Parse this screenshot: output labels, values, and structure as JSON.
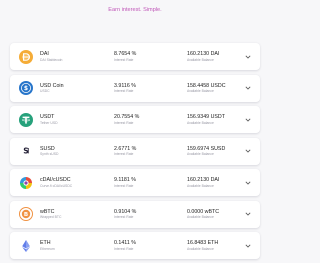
{
  "header": {
    "tagline": "Earn interest. Simple."
  },
  "assets": [
    {
      "symbol": "DAI",
      "name": "DAI Stablecoin",
      "rate": "8.7654 %",
      "rate_label": "Interest Rate",
      "balance": "160.2130 DAI",
      "balance_label": "Available Balance",
      "icon": "dai-icon"
    },
    {
      "symbol": "USD Coin",
      "name": "USDC",
      "rate": "3.9116 %",
      "rate_label": "Interest Rate",
      "balance": "158.4458 USDC",
      "balance_label": "Available Balance",
      "icon": "usdc-icon"
    },
    {
      "symbol": "USDT",
      "name": "Tether USD",
      "rate": "20.7554 %",
      "rate_label": "Interest Rate",
      "balance": "156.9349 USDT",
      "balance_label": "Available Balance",
      "icon": "usdt-icon"
    },
    {
      "symbol": "SUSD",
      "name": "Synth sUSD",
      "rate": "2.6771 %",
      "rate_label": "Interest Rate",
      "balance": "159.6974 SUSD",
      "balance_label": "Available Balance",
      "icon": "susd-icon"
    },
    {
      "symbol": "cDAI/cUSDC",
      "name": "Curve.fi cDAI/cUSDC",
      "rate": "9.1181 %",
      "rate_label": "Interest Rate",
      "balance": "160.2130 DAI",
      "balance_label": "Available Balance",
      "icon": "curve-icon"
    },
    {
      "symbol": "wBTC",
      "name": "Wrapped BTC",
      "rate": "0.9104 %",
      "rate_label": "Interest Rate",
      "balance": "0.0000 wBTC",
      "balance_label": "Available Balance",
      "icon": "wbtc-icon"
    },
    {
      "symbol": "ETH",
      "name": "Ethereum",
      "rate": "0.1411 %",
      "rate_label": "Interest Rate",
      "balance": "16.8483 ETH",
      "balance_label": "Available Balance",
      "icon": "eth-icon"
    }
  ],
  "colors": {
    "accent": "#c056b8",
    "dai": "#f5ac37",
    "usdc": "#2775ca",
    "usdt": "#26a17b",
    "wbtc": "#f09242",
    "eth": "#627eea"
  }
}
